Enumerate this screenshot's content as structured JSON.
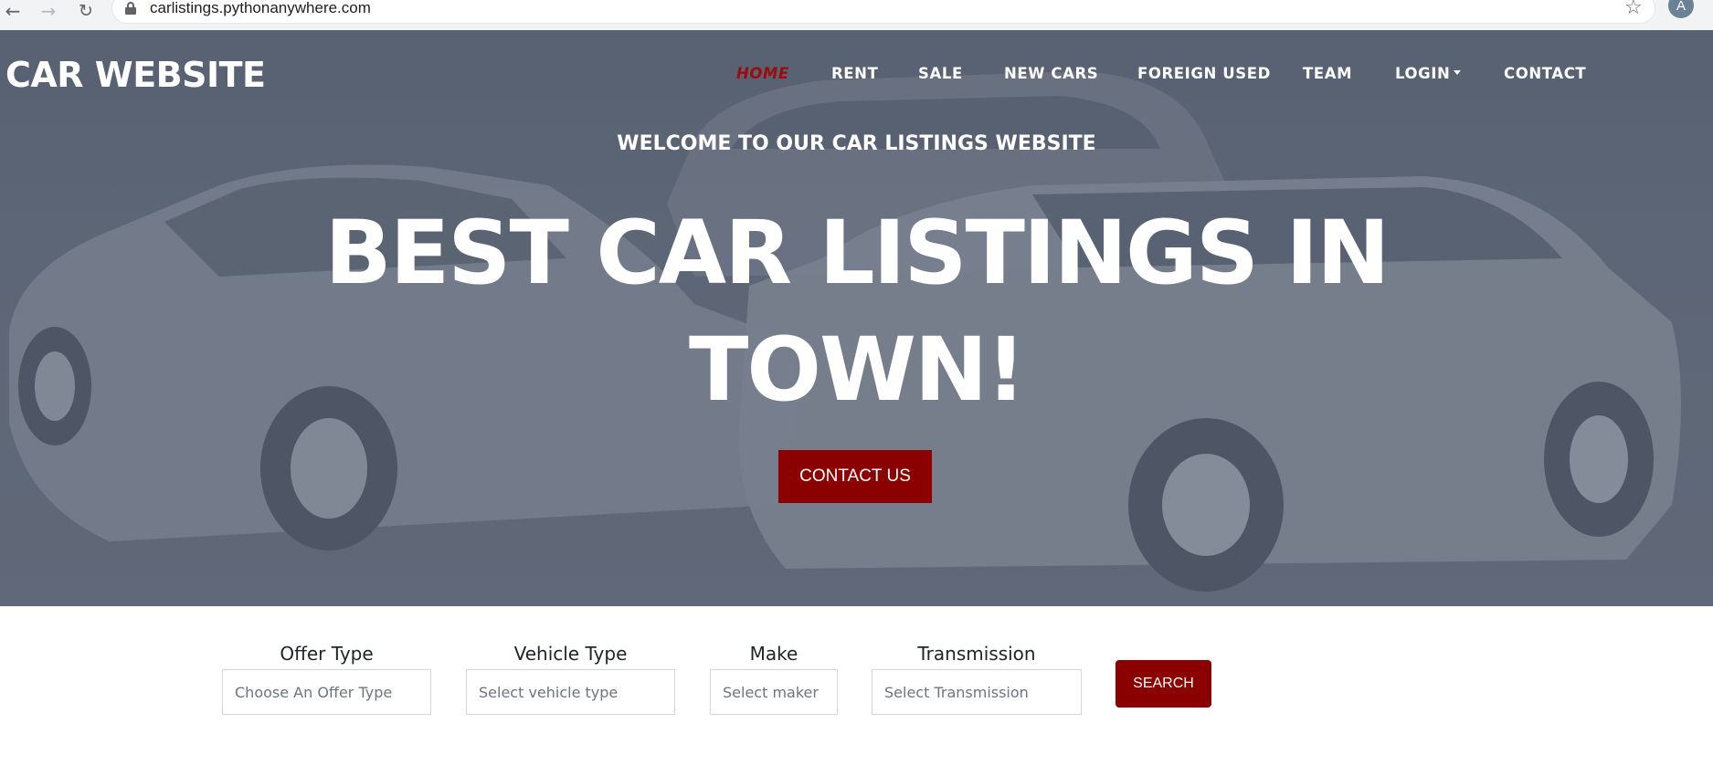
{
  "browser": {
    "url": "carlistings.pythonanywhere.com",
    "profile_initial": "A"
  },
  "header": {
    "brand": "CAR WEBSITE",
    "nav": [
      {
        "label": "HOME",
        "active": true
      },
      {
        "label": "RENT"
      },
      {
        "label": "SALE"
      },
      {
        "label": "NEW CARS"
      },
      {
        "label": "FOREIGN USED"
      },
      {
        "label": "TEAM"
      },
      {
        "label": "LOGIN",
        "dropdown": true
      },
      {
        "label": "CONTACT"
      }
    ]
  },
  "hero": {
    "welcome": "WELCOME TO OUR CAR LISTINGS WEBSITE",
    "headline": "BEST CAR LISTINGS IN TOWN!",
    "cta_label": "CONTACT US"
  },
  "search": {
    "fields": [
      {
        "label": "Offer Type",
        "placeholder": "Choose An Offer Type"
      },
      {
        "label": "Vehicle Type",
        "placeholder": "Select vehicle type"
      },
      {
        "label": "Make",
        "placeholder": "Select maker"
      },
      {
        "label": "Transmission",
        "placeholder": "Select Transmission"
      }
    ],
    "button_label": "SEARCH"
  },
  "colors": {
    "accent": "#8b0000",
    "active_nav": "#9e0a0a",
    "hero_overlay": "#5d6676"
  }
}
